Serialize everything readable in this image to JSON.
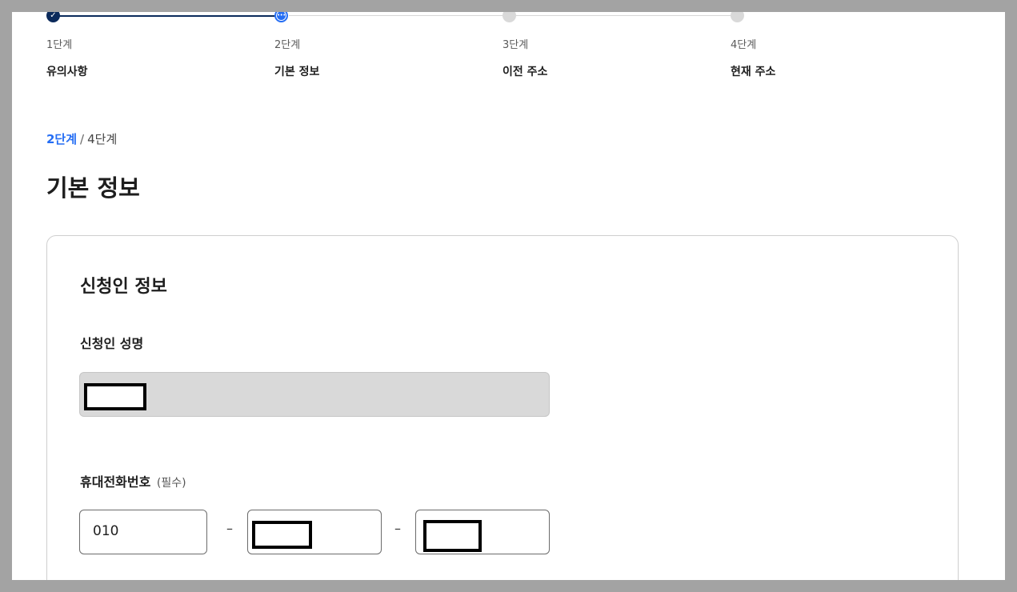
{
  "stepper": {
    "steps": [
      {
        "number": "1단계",
        "label": "유의사항",
        "status": "done"
      },
      {
        "number": "2단계",
        "label": "기본 정보",
        "status": "current"
      },
      {
        "number": "3단계",
        "label": "이전 주소",
        "status": "todo"
      },
      {
        "number": "4단계",
        "label": "현재 주소",
        "status": "todo"
      }
    ],
    "done_check": "✓",
    "current_marker": "•••"
  },
  "progress": {
    "current": "2단계",
    "separator": "/",
    "total": "4단계"
  },
  "page_title": "기본 정보",
  "card": {
    "title": "신청인 정보",
    "name_field": {
      "label": "신청인 성명",
      "value": ""
    },
    "phone_field": {
      "label": "휴대전화번호",
      "required": "(필수)",
      "part1": "010",
      "part2": "",
      "part3": "",
      "dash": "–"
    }
  },
  "colors": {
    "accent": "#256ef4",
    "done": "#0b2a5b",
    "todo": "#d9d9d9",
    "disabled_input": "#d9d9d9"
  }
}
